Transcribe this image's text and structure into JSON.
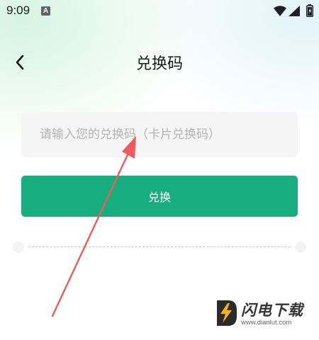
{
  "status_bar": {
    "time": "9:09",
    "notification_icon": "A"
  },
  "header": {
    "title": "兑换码"
  },
  "form": {
    "code_placeholder": "请输入您的兑换码（卡片兑换码）",
    "code_value": "",
    "redeem_label": "兑换"
  },
  "colors": {
    "accent": "#17ad7f",
    "annotation_arrow": "#f05a5a"
  },
  "watermark": {
    "brand": "闪电下载",
    "url": "www.dianlut.com"
  }
}
